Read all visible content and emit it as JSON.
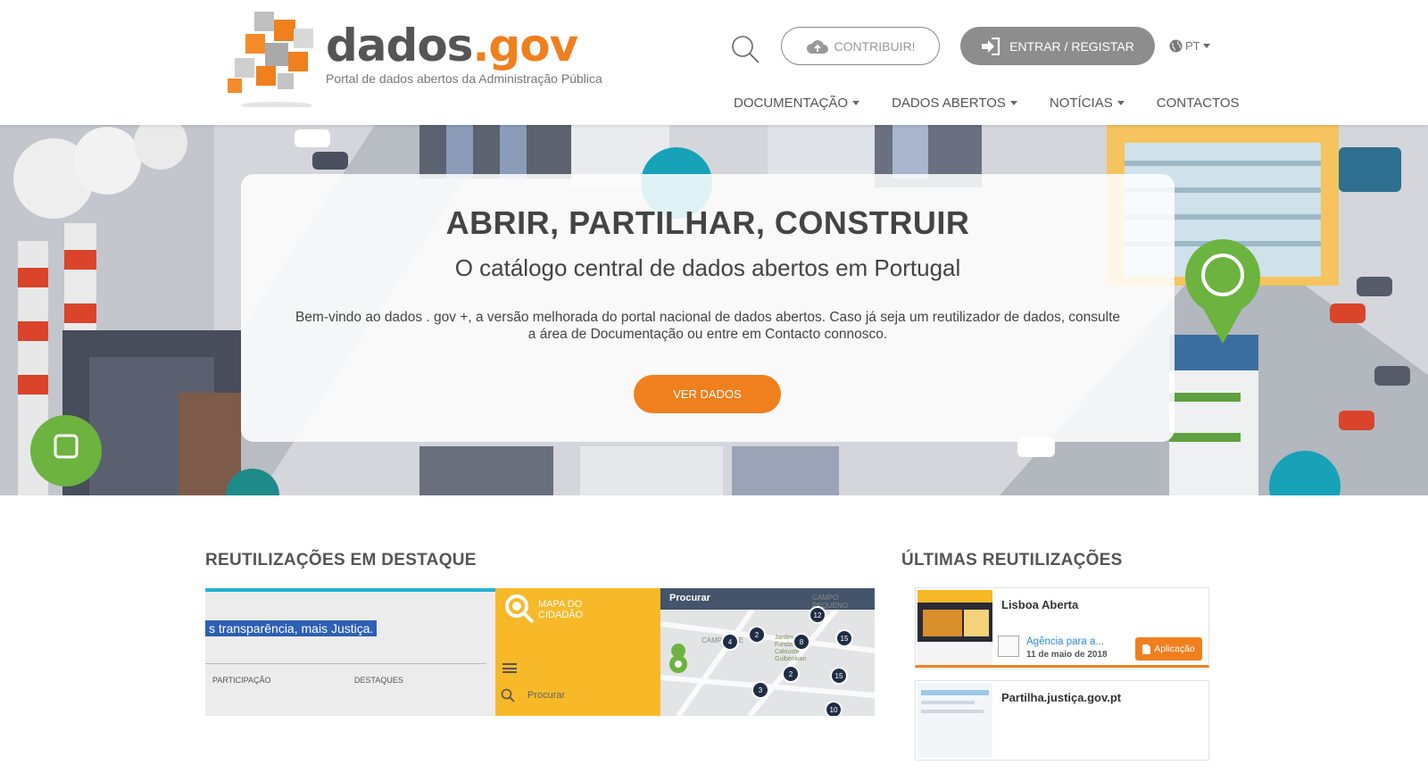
{
  "header": {
    "logo": {
      "word_main": "dados",
      "word_accent": ".gov",
      "tagline": "Portal de dados abertos da Administração Pública"
    },
    "contribute_label": "CONTRIBUIR!",
    "login_label": "ENTRAR / REGISTAR",
    "language": "PT",
    "nav": [
      {
        "label": "DOCUMENTAÇÃO",
        "dropdown": true
      },
      {
        "label": "DADOS ABERTOS",
        "dropdown": true
      },
      {
        "label": "NOTÍCIAS",
        "dropdown": true
      },
      {
        "label": "CONTACTOS",
        "dropdown": false
      }
    ]
  },
  "hero": {
    "title": "ABRIR, PARTILHAR, CONSTRUIR",
    "subtitle": "O catálogo central de dados abertos em Portugal",
    "text_line1": "Bem-vindo ao dados . gov +, a versão melhorada do portal nacional de dados abertos. Caso já seja um reutilizador de dados, consulte",
    "text_line2": "a área de Documentação ou entre em Contacto connosco.",
    "button_label": "VER DADOS"
  },
  "featured": {
    "title": "REUTILIZAÇÕES EM DESTAQUE",
    "tile1": {
      "headline": "s transparência, mais Justiça.",
      "menu1": "PARTICIPAÇÃO",
      "menu2": "DESTAQUES"
    },
    "tile2": {
      "name1": "MAPA DO",
      "name2": "CIDADÃO",
      "search": "Procurar"
    },
    "tile3": {
      "search": "Procurar",
      "place1": "CAMPO PEQUENO",
      "place2": "CAMPOLIDE",
      "place3": "Jardim Fundação Calouste Gulbenkian",
      "clusters": [
        "12",
        "2",
        "4",
        "8",
        "15",
        "2",
        "15",
        "3",
        "10"
      ]
    }
  },
  "latest": {
    "title": "ÚLTIMAS REUTILIZAÇÕES",
    "items": [
      {
        "title": "Lisboa Aberta",
        "org": "Agência para a...",
        "date": "11 de maio de 2018",
        "tag": "Aplicação"
      },
      {
        "title": "Partilha.justiça.gov.pt"
      }
    ]
  },
  "colors": {
    "accent": "#f07f1e",
    "grey_button": "#8d8d8d",
    "link": "#2a8bd6"
  }
}
